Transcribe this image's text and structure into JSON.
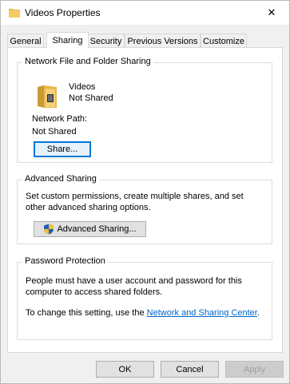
{
  "window": {
    "title": "Videos Properties",
    "close_glyph": "✕"
  },
  "tabs": [
    {
      "label": "General"
    },
    {
      "label": "Sharing"
    },
    {
      "label": "Security"
    },
    {
      "label": "Previous Versions"
    },
    {
      "label": "Customize"
    }
  ],
  "network_sharing": {
    "group_title": "Network File and Folder Sharing",
    "folder_name": "Videos",
    "share_status": "Not Shared",
    "network_path_label": "Network Path:",
    "network_path_value": "Not Shared",
    "share_button": "Share..."
  },
  "advanced_sharing": {
    "group_title": "Advanced Sharing",
    "description": "Set custom permissions, create multiple shares, and set other advanced sharing options.",
    "button": "Advanced Sharing..."
  },
  "password_protection": {
    "group_title": "Password Protection",
    "description": "People must have a user account and password for this computer to access shared folders.",
    "change_prefix": "To change this setting, use the",
    "link_text": "Network and Sharing Center",
    "change_suffix": "."
  },
  "footer": {
    "ok": "OK",
    "cancel": "Cancel",
    "apply": "Apply"
  },
  "icons": {
    "title_icon": "folder-icon",
    "folder_icon": "video-folder-icon",
    "shield_icon": "uac-shield-icon"
  },
  "colors": {
    "link": "#0066cc",
    "focus_border": "#0078d7",
    "folder": "#e8b84a"
  }
}
